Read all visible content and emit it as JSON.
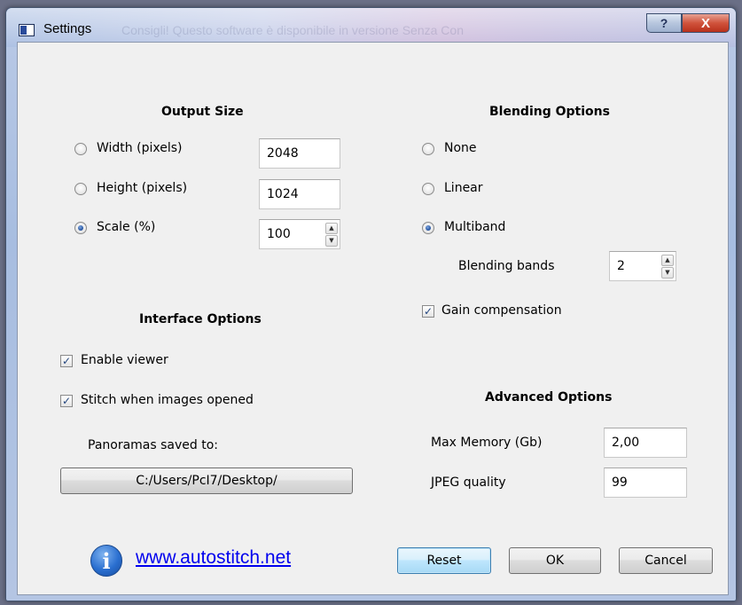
{
  "window": {
    "title": "Settings",
    "background_title_text": "Consigli! Questo software è disponibile in versione Senza Con",
    "help_button": "?",
    "close_button": "X"
  },
  "output_size": {
    "heading": "Output Size",
    "width_label": "Width (pixels)",
    "width_value": "2048",
    "height_label": "Height (pixels)",
    "height_value": "1024",
    "scale_label": "Scale (%)",
    "scale_value": "100",
    "selected": "scale"
  },
  "blending": {
    "heading": "Blending Options",
    "none_label": "None",
    "linear_label": "Linear",
    "multiband_label": "Multiband",
    "selected": "multiband",
    "bands_label": "Blending bands",
    "bands_value": "2",
    "gain_label": "Gain compensation",
    "gain_checked": true
  },
  "interface": {
    "heading": "Interface Options",
    "enable_viewer_label": "Enable viewer",
    "enable_viewer_checked": true,
    "stitch_label": "Stitch when images opened",
    "stitch_checked": true,
    "saved_to_label": "Panoramas saved to:",
    "path_button": "C:/Users/PcI7/Desktop/"
  },
  "advanced": {
    "heading": "Advanced Options",
    "memory_label": "Max Memory (Gb)",
    "memory_value": "2,00",
    "jpeg_label": "JPEG quality",
    "jpeg_value": "99"
  },
  "footer": {
    "info_icon": "info-icon",
    "link_text": "www.autostitch.net",
    "reset_button": "Reset",
    "ok_button": "OK",
    "cancel_button": "Cancel"
  },
  "colors": {
    "link": "#0000ee",
    "client_bg": "#f0f0f0",
    "close_red": "#c8412b"
  }
}
